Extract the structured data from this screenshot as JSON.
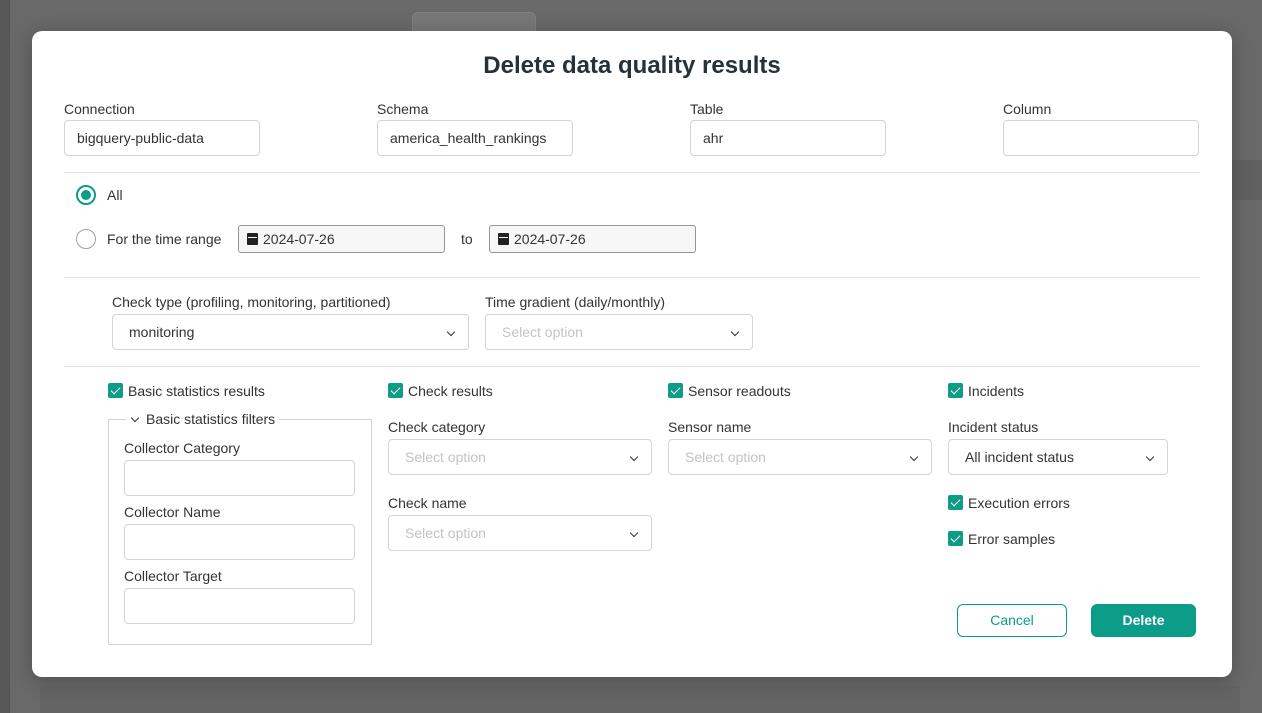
{
  "dialog": {
    "title": "Delete data quality results"
  },
  "target": {
    "connection_label": "Connection",
    "connection_value": "bigquery-public-data",
    "schema_label": "Schema",
    "schema_value": "america_health_rankings",
    "table_label": "Table",
    "table_value": "ahr",
    "column_label": "Column",
    "column_value": ""
  },
  "range": {
    "all_label": "All",
    "all_selected": true,
    "time_range_label": "For the time range",
    "from_date": "2024-07-26",
    "to_label": "to",
    "to_date": "2024-07-26"
  },
  "filters": {
    "check_type_label": "Check type (profiling, monitoring, partitioned)",
    "check_type_value": "monitoring",
    "time_gradient_label": "Time gradient (daily/monthly)",
    "time_gradient_placeholder": "Select option"
  },
  "basic_stats": {
    "checkbox_label": "Basic statistics results",
    "filters_legend": "Basic statistics filters",
    "collector_category_label": "Collector Category",
    "collector_name_label": "Collector Name",
    "collector_target_label": "Collector Target"
  },
  "check_results": {
    "checkbox_label": "Check results",
    "category_label": "Check category",
    "category_placeholder": "Select option",
    "name_label": "Check name",
    "name_placeholder": "Select option"
  },
  "sensor_readouts": {
    "checkbox_label": "Sensor readouts",
    "sensor_name_label": "Sensor name",
    "sensor_name_placeholder": "Select option"
  },
  "incidents": {
    "checkbox_label": "Incidents",
    "status_label": "Incident status",
    "status_value": "All incident status",
    "execution_errors_label": "Execution errors",
    "error_samples_label": "Error samples"
  },
  "actions": {
    "cancel_label": "Cancel",
    "delete_label": "Delete"
  },
  "colors": {
    "accent": "#0c9c87",
    "title": "#263238"
  }
}
